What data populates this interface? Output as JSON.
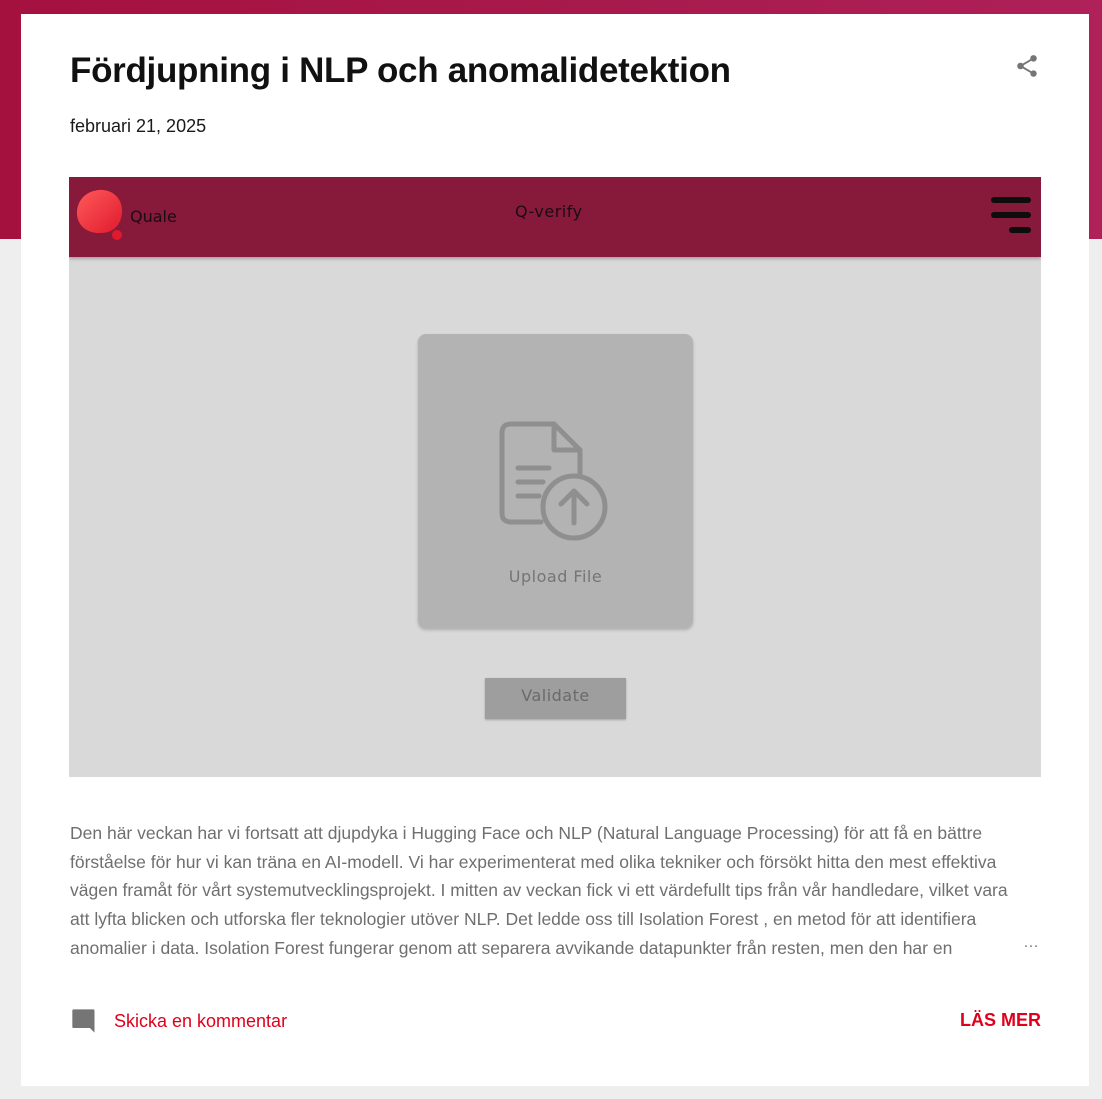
{
  "colors": {
    "header_band": "#a5113f",
    "app_navbar": "#87193a",
    "link_red": "#e0001b",
    "excerpt_text": "#6f6f6f"
  },
  "post": {
    "title": "Fördjupning i NLP och anomalidetektion",
    "date": "februari 21, 2025",
    "share_icon": "share-icon",
    "excerpt_lines": [
      "Den här veckan har vi fortsatt att djupdyka i Hugging Face och NLP (Natural Language Processing) för att få en bättre",
      "förståelse för hur vi kan träna en AI-modell. Vi har experimenterat med olika tekniker och försökt hitta den mest effektiva",
      "vägen framåt för vårt systemutvecklingsprojekt. I mitten av veckan fick vi ett värdefullt tips från vår handledare, vilket vara",
      "att lyfta blicken och utforska fler teknologier utöver NLP. Det ledde oss till Isolation Forest , en metod för att identifiera",
      "anomalier i data. Isolation Forest fungerar genom att separera avvikande datapunkter från resten, men den har en"
    ],
    "ellipsis": "…",
    "comment_label": "Skicka en kommentar",
    "read_more_label": "LÄS MER"
  },
  "featured_app": {
    "logo_text": "Quale",
    "title": "Q-verify",
    "upload_label": "Upload File",
    "validate_label": "Validate",
    "menu_icon": "hamburger-menu-icon",
    "upload_icon": "file-upload-icon"
  }
}
